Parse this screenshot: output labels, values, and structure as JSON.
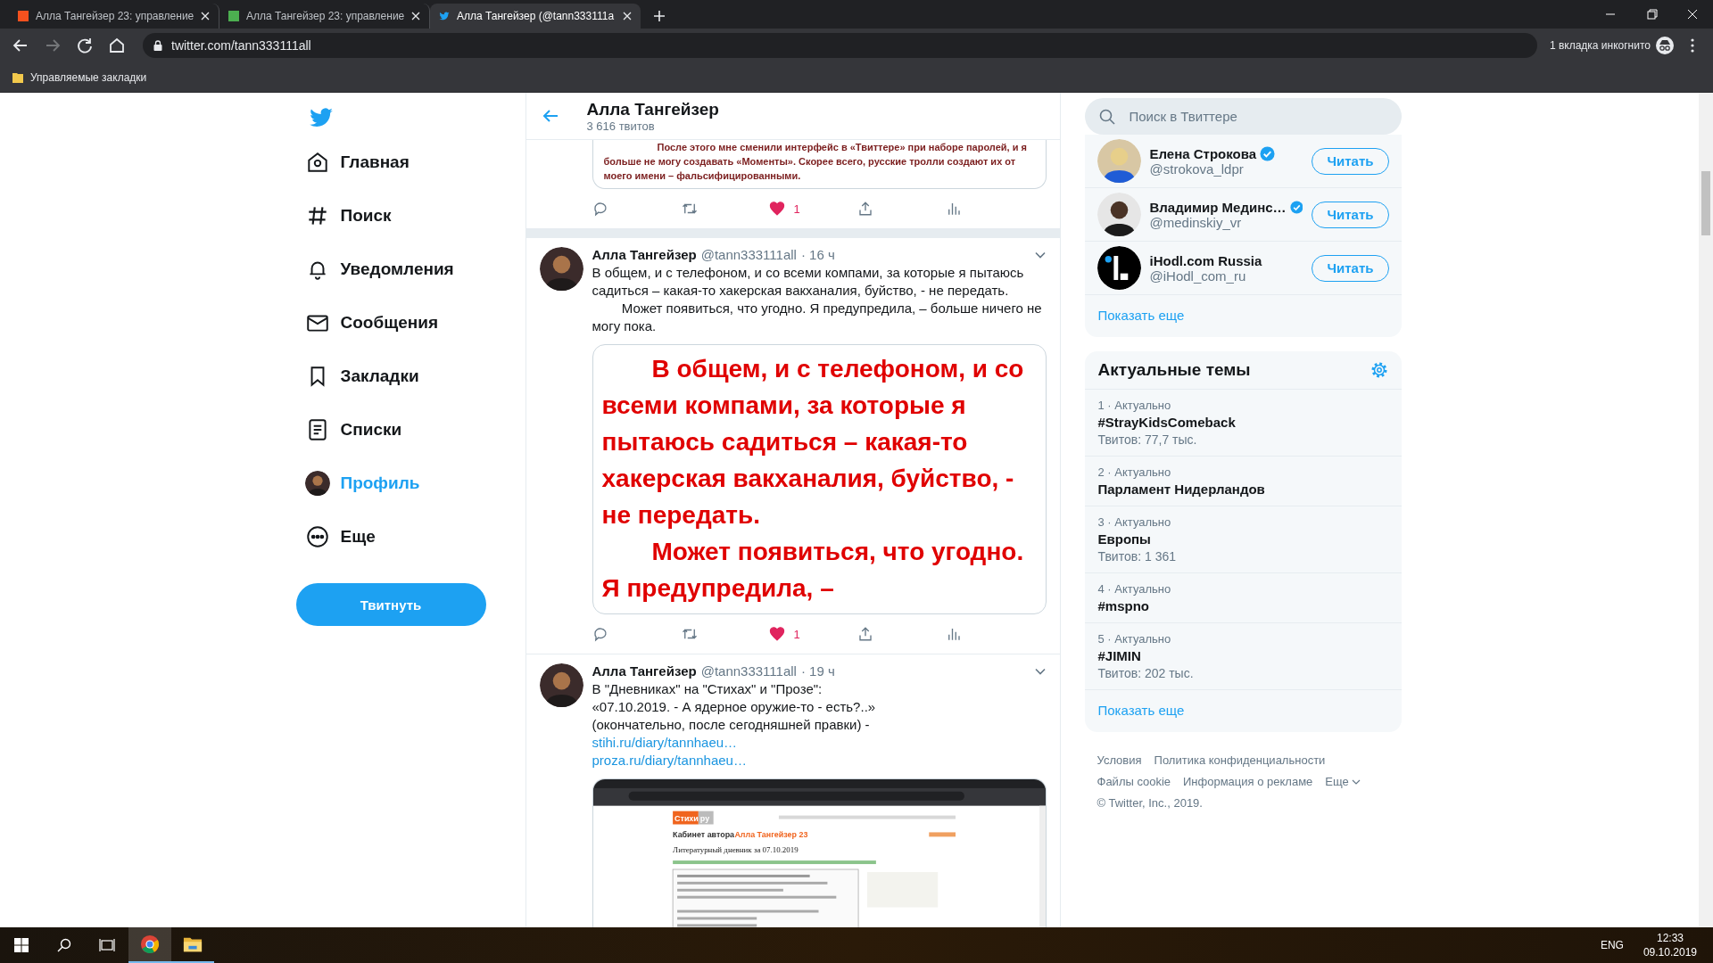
{
  "browser": {
    "tabs": [
      {
        "title": "Алла Тангейзер 23: управление",
        "kind": "square",
        "color": "#f4511e",
        "selected": false
      },
      {
        "title": "Алла Тангейзер 23: управление",
        "kind": "square",
        "color": "#4caf50",
        "selected": false
      },
      {
        "title": "Алла Тангейзер (@tann333111a",
        "kind": "bird",
        "color": "#1da1f2",
        "selected": true
      }
    ],
    "url": "twitter.com/tann333111all",
    "incognito": "1 вкладка инкогнито",
    "bookmarks": [
      "Управляемые закладки"
    ]
  },
  "nav": {
    "items": [
      {
        "label": "Главная",
        "selected": false
      },
      {
        "label": "Поиск",
        "selected": false
      },
      {
        "label": "Уведомления",
        "selected": false
      },
      {
        "label": "Сообщения",
        "selected": false
      },
      {
        "label": "Закладки",
        "selected": false
      },
      {
        "label": "Списки",
        "selected": false
      },
      {
        "label": "Профиль",
        "selected": true
      },
      {
        "label": "Еще",
        "selected": false
      }
    ],
    "tweet_button": "Твитнуть"
  },
  "header": {
    "name": "Алла Тангейзер",
    "tweet_count": "3 616 твитов"
  },
  "tweets": [
    {
      "kind": "cut",
      "image": {
        "kind": "text",
        "paragraphs": [
          "После этого мне сменили интерфейс в «Твиттере» при наборе паролей, и я больше не могу создавать «Моменты». Скорее всего, русские тролли создают их от моего имени – фальсифицированными."
        ]
      },
      "liked": true,
      "likes": "1"
    },
    {
      "kind": "full",
      "author": "Алла Тангейзер",
      "handle": "@tann333111all",
      "time": "· 16 ч",
      "text": "В общем, и с телефоном, и со всеми компами, за которые я пытаюсь садиться – какая-то хакерская вакханалия, буйство, - не передать.\n        Может появиться, что угодно. Я предупредила, – больше ничего не могу пока.",
      "image": {
        "kind": "big_text",
        "paragraphs": [
          "В общем, и с телефоном, и со всеми компами, за которые я пытаюсь садиться – какая-то хакерская вакханалия, буйство, - не передать.",
          "Может появиться, что угодно. Я предупредила, –"
        ]
      },
      "liked": true,
      "likes": "1"
    },
    {
      "kind": "full",
      "author": "Алла Тангейзер",
      "handle": "@tann333111all",
      "time": "· 19 ч",
      "text": "В \"Дневниках\" на \"Стихах\" и \"Прозе\":\n«07.10.2019. - А ядерное оружие-то - есть?..»\n(окончательно, после сегодняшней правки) -",
      "links": [
        "stihi.ru/diary/tannhaeu…",
        "proza.ru/diary/tannhaeu…"
      ],
      "image": {
        "kind": "screenshot",
        "logo": [
          "Стихи",
          "ру"
        ],
        "cabinet": "Кабинет автора",
        "author": "Алла Тангейзер 23",
        "diary": "Литературный дневник за 07.10.2019"
      }
    }
  ],
  "search": {
    "placeholder": "Поиск в Твиттере"
  },
  "follow": {
    "items": [
      {
        "name": "Елена Строкова",
        "handle": "@strokova_ldpr",
        "verified": true,
        "kind": "photo",
        "button": "Читать"
      },
      {
        "name": "Владимир Мединс…",
        "handle": "@medinskiy_vr",
        "verified": true,
        "kind": "photo",
        "button": "Читать"
      },
      {
        "name": "iHodl.com Russia",
        "handle": "@iHodl_com_ru",
        "verified": false,
        "kind": "logo",
        "button": "Читать"
      }
    ],
    "more": "Показать еще"
  },
  "trends": {
    "title": "Актуальные темы",
    "items": [
      {
        "meta": "1 · Актуально",
        "name": "#StrayKidsComeback",
        "count": "Твитов: 77,7 тыс."
      },
      {
        "meta": "2 · Актуально",
        "name": "Парламент Нидерландов"
      },
      {
        "meta": "3 · Актуально",
        "name": "Европы",
        "count": "Твитов: 1 361"
      },
      {
        "meta": "4 · Актуально",
        "name": "#mspno"
      },
      {
        "meta": "5 · Актуально",
        "name": "#JIMIN",
        "count": "Твитов: 202 тыс."
      }
    ],
    "more": "Показать еще"
  },
  "footer": {
    "links": [
      "Условия",
      "Политика конфиденциальности",
      "Файлы cookie",
      "Информация о рекламе"
    ],
    "more": "Еще",
    "copyright": "© Twitter, Inc., 2019."
  },
  "taskbar": {
    "apps": [
      {
        "kind": "chrome",
        "selected": true
      },
      {
        "kind": "folder",
        "selected": false
      }
    ],
    "language": "ENG",
    "time": "12:33",
    "date": "09.10.2019"
  }
}
